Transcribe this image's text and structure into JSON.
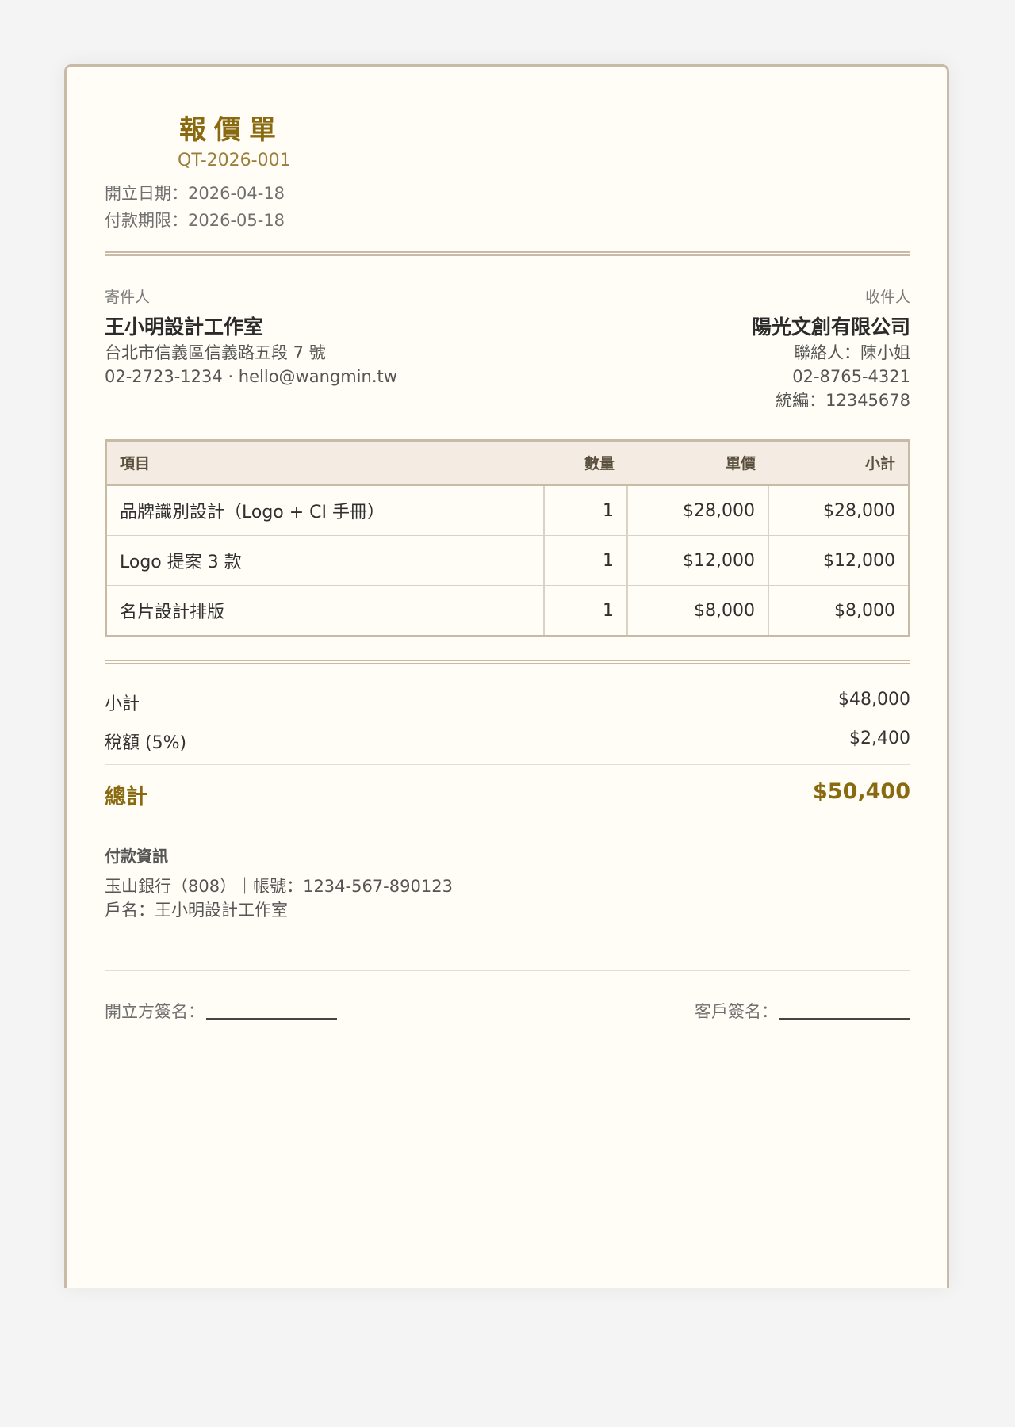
{
  "header": {
    "title": "報價單",
    "number": "QT-2026-001",
    "issue_date": "開立日期：2026-04-18",
    "due_date": "付款期限：2026-05-18"
  },
  "sender": {
    "label": "寄件人",
    "name": "王小明設計工作室",
    "address": "台北市信義區信義路五段 7 號",
    "contact": "02-2723-1234 · hello@wangmin.tw"
  },
  "recipient": {
    "label": "收件人",
    "name": "陽光文創有限公司",
    "contact_person": "聯絡人：陳小姐",
    "phone": "02-8765-4321",
    "tax_id": "統編：12345678"
  },
  "items_table": {
    "headers": [
      "項目",
      "數量",
      "單價",
      "小計"
    ],
    "rows": [
      [
        "品牌識別設計（Logo + CI 手冊）",
        "1",
        "$28,000",
        "$28,000"
      ],
      [
        "Logo 提案 3 款",
        "1",
        "$12,000",
        "$12,000"
      ],
      [
        "名片設計排版",
        "1",
        "$8,000",
        "$8,000"
      ]
    ]
  },
  "summary": {
    "subtotal_label": "小計",
    "subtotal_value": "$48,000",
    "tax_label": "稅額 (5%)",
    "tax_value": "$2,400",
    "total_label": "總計",
    "total_value": "$50,400"
  },
  "payment": {
    "title": "付款資訊",
    "bank_line": "玉山銀行（808）｜帳號：1234-567-890123",
    "account_name": "戶名：王小明設計工作室"
  },
  "signatures": {
    "issuer_label": "開立方簽名：",
    "client_label": "客戶簽名："
  },
  "colors": {
    "accent": "#8a6a10",
    "border": "#c8baa6",
    "paper": "#fffdf5",
    "table_header_bg": "#f4ece3"
  }
}
